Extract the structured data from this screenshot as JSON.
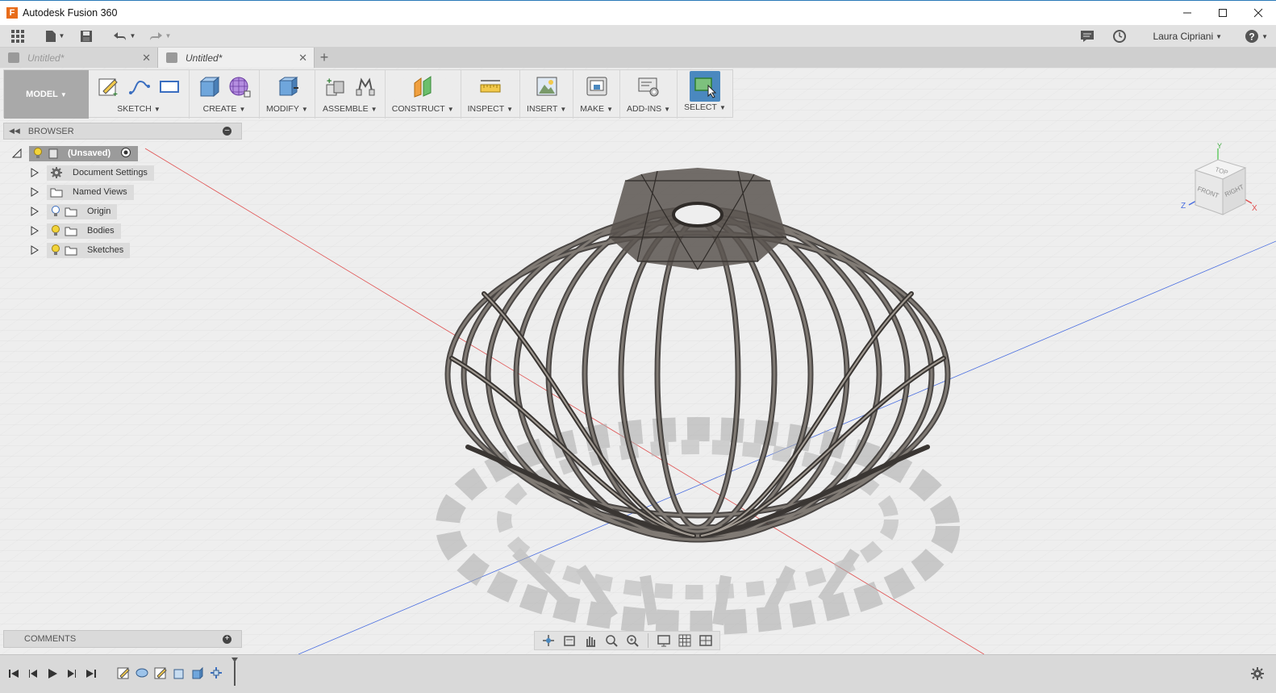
{
  "window": {
    "app_logo": "F",
    "title": "Autodesk Fusion 360"
  },
  "qat": {
    "user_name": "Laura Cipriani"
  },
  "tabs": [
    {
      "label": "Untitled*",
      "active": false
    },
    {
      "label": "Untitled*",
      "active": true
    }
  ],
  "ribbon": {
    "workspace": "MODEL",
    "groups": [
      "SKETCH",
      "CREATE",
      "MODIFY",
      "ASSEMBLE",
      "CONSTRUCT",
      "INSPECT",
      "INSERT",
      "MAKE",
      "ADD-INS",
      "SELECT"
    ]
  },
  "browser": {
    "title": "BROWSER",
    "root": "(Unsaved)",
    "items": [
      {
        "label": "Document Settings",
        "icon": "gear-icon"
      },
      {
        "label": "Named Views",
        "icon": "folder-icon"
      },
      {
        "label": "Origin",
        "icon": "folder-icon",
        "bulb": "off"
      },
      {
        "label": "Bodies",
        "icon": "folder-icon",
        "bulb": "on"
      },
      {
        "label": "Sketches",
        "icon": "folder-icon",
        "bulb": "on"
      }
    ]
  },
  "comments": {
    "title": "COMMENTS"
  },
  "viewcube": {
    "top": "TOP",
    "front": "FRONT",
    "right": "RIGHT",
    "axis_x": "X",
    "axis_y": "Y",
    "axis_z": "Z"
  },
  "colors": {
    "title_accent": "#2a7ab8",
    "select_active": "#4a88bf",
    "axis_red": "#e05050",
    "axis_blue": "#4a6ee0",
    "model_color": "#6a6560"
  }
}
